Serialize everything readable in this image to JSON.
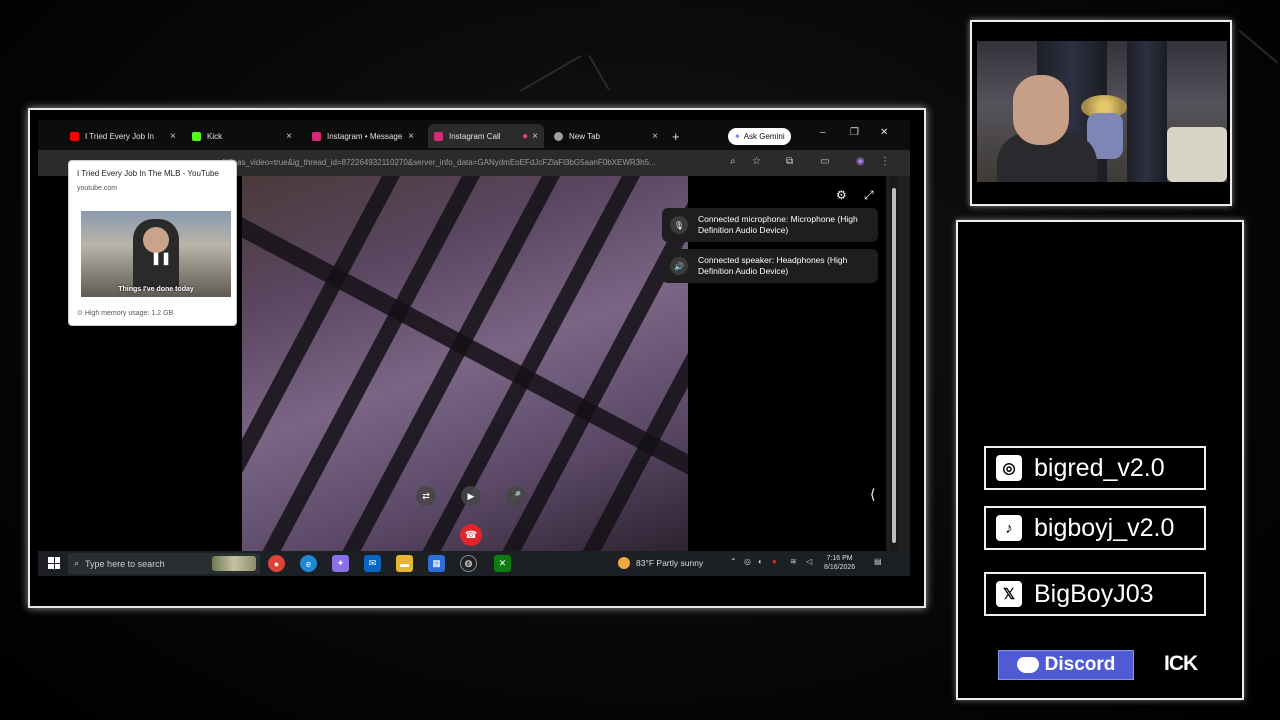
{
  "browser": {
    "tabs": [
      {
        "title": "I Tried Every Job In",
        "color": "#ff0000"
      },
      {
        "title": "Kick",
        "color": "#53fc18"
      },
      {
        "title": "Instagram • Message",
        "color": "#d62976"
      },
      {
        "title": "Instagram Call",
        "color": "#d62976"
      },
      {
        "title": "New Tab",
        "color": "#9aa0a6"
      }
    ],
    "new_tab_glyph": "+",
    "ask_gemini": "Ask Gemini",
    "url": "all/?has_video=true&ig_thread_id=872264932110270&server_info_data=GANydmEoEFdJcFZlaFl3bG5aanF0bXEWR3h5..."
  },
  "hover_card": {
    "title": "I Tried Every Job In The MLB - YouTube",
    "domain": "youtube.com",
    "thumbnail_caption": "Things I've done today",
    "memory": "High memory usage: 1.2 GB"
  },
  "call": {
    "mic_notice": "Connected microphone: Microphone (High Definition Audio Device)",
    "speaker_notice": "Connected speaker: Headphones (High Definition Audio Device)"
  },
  "taskbar": {
    "search_placeholder": "Type here to search",
    "weather": "83°F  Partly sunny",
    "time": "7:16 PM",
    "date": "8/16/2026"
  },
  "socials": [
    {
      "platform": "instagram-icon",
      "handle": "bigred_v2.0"
    },
    {
      "platform": "tiktok-icon",
      "handle": "bigboyj_v2.0"
    },
    {
      "platform": "x-icon",
      "handle": "BigBoyJ03"
    }
  ],
  "discord_label": "Discord",
  "kick_label": "ICK",
  "colors": {
    "hangup": "#e0242c",
    "discord": "#4f5bd5"
  }
}
